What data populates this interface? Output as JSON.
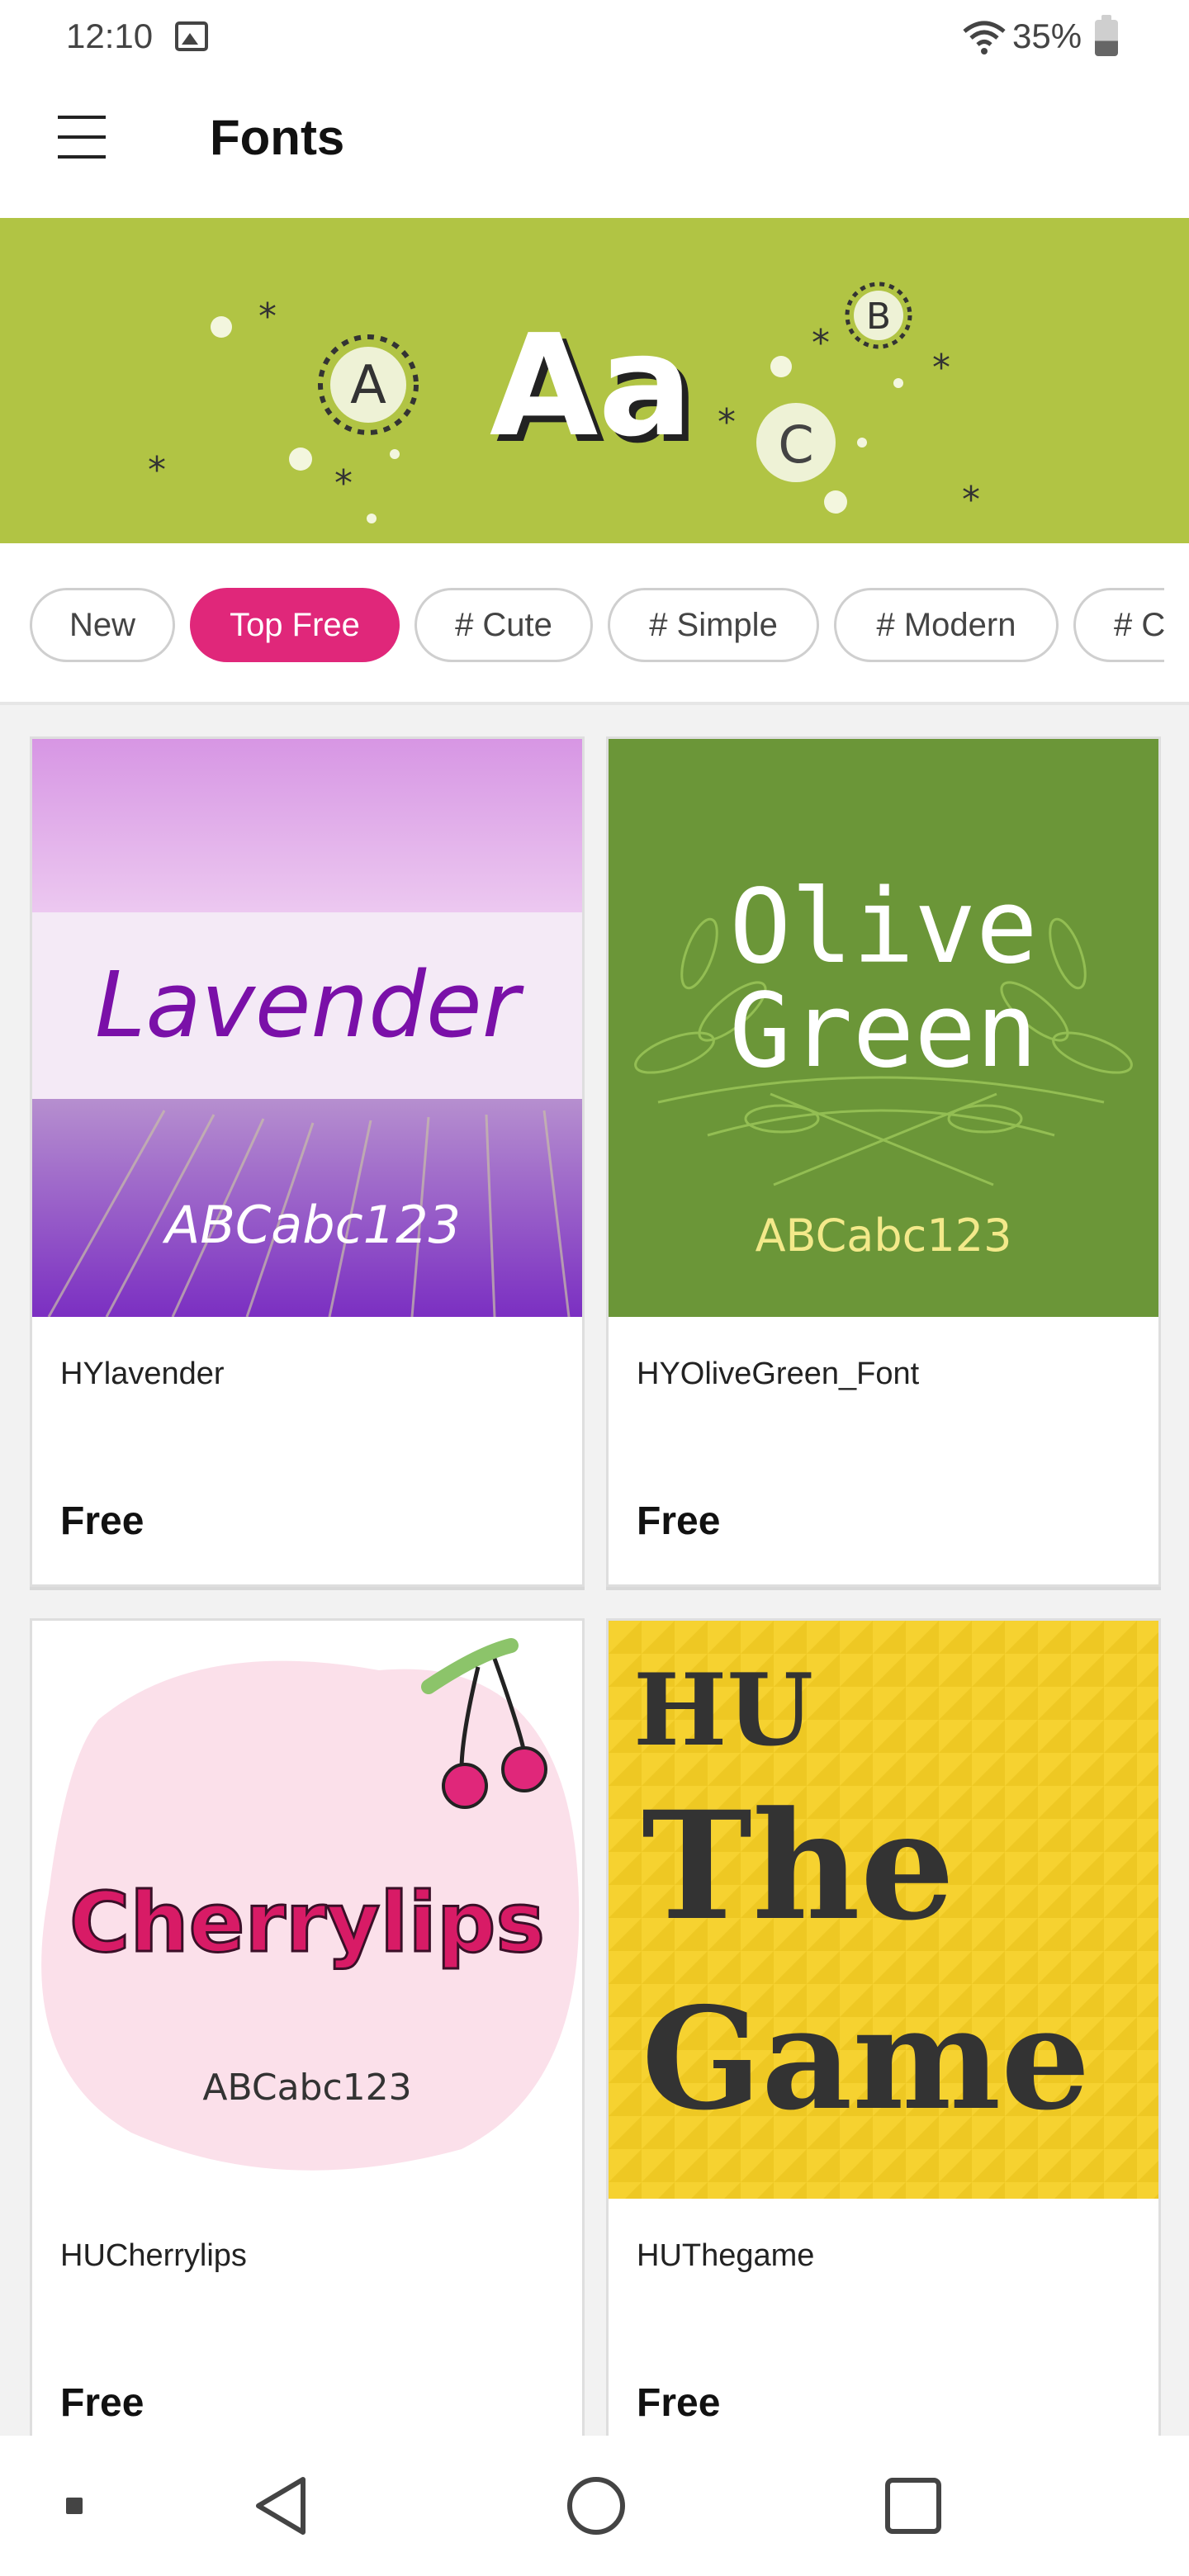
{
  "status_bar": {
    "time": "12:10",
    "battery_percent": "35%",
    "icons": [
      "image-icon",
      "wifi-icon",
      "battery-icon"
    ]
  },
  "app_bar": {
    "title": "Fonts",
    "menu_icon": "menu-icon"
  },
  "banner": {
    "text": "Aa",
    "letters": [
      "A",
      "B",
      "C"
    ],
    "background_color": "#b1c444"
  },
  "chips": [
    {
      "label": "New",
      "active": false
    },
    {
      "label": "Top Free",
      "active": true
    },
    {
      "label": "# Cute",
      "active": false
    },
    {
      "label": "# Simple",
      "active": false
    },
    {
      "label": "# Modern",
      "active": false
    },
    {
      "label": "# C",
      "active": false
    }
  ],
  "accent_color": "#e0277a",
  "fonts": [
    {
      "name": "HYlavender",
      "price": "Free",
      "preview_title": "Lavender",
      "preview_sample": "ABCabc123"
    },
    {
      "name": "HYOliveGreen_Font",
      "price": "Free",
      "preview_title_line1": "Olive",
      "preview_title_line2": "Green",
      "preview_sample": "ABCabc123"
    },
    {
      "name": "HUCherrylips",
      "price": "Free",
      "preview_title": "Cherrylips",
      "preview_sample": "ABCabc123"
    },
    {
      "name": "HUThegame",
      "price": "Free",
      "preview_title_line1": "HU",
      "preview_title_line2": "The",
      "preview_title_line3": "Game"
    }
  ],
  "nav_bar": {
    "items": [
      "recent-dot-icon",
      "back-icon",
      "home-icon",
      "overview-icon"
    ]
  }
}
